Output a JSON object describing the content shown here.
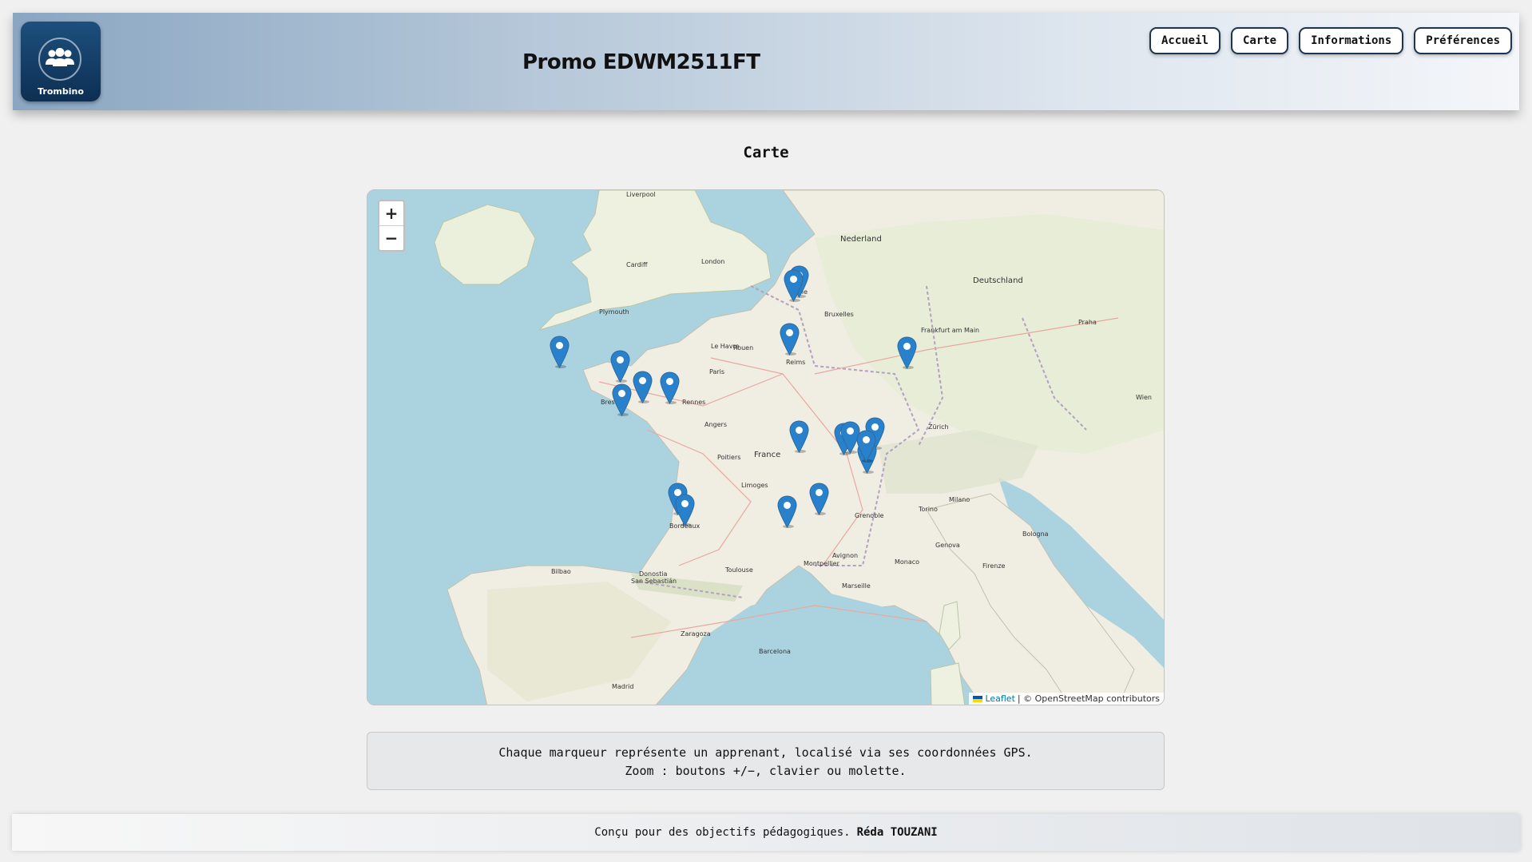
{
  "header": {
    "logo_label": "Trombino",
    "logo_icon": "users-group-icon",
    "title": "Promo EDWM2511FT",
    "nav": [
      "Accueil",
      "Carte",
      "Informations",
      "Préférences"
    ]
  },
  "main": {
    "section_title": "Carte",
    "map": {
      "zoom_in_label": "+",
      "zoom_out_label": "−",
      "attribution_link": "Leaflet",
      "attribution_text": "| © OpenStreetMap contributors",
      "marker_count": 19,
      "marker_icon": "map-pin-icon",
      "marker_color": "#2a81cb",
      "place_labels": [
        "Paris",
        "Brest",
        "Rennes",
        "Angers",
        "Bordeaux",
        "Toulouse",
        "Montpellier",
        "Marseille",
        "Grenoble",
        "Limoges",
        "Poitiers",
        "London",
        "Liverpool",
        "Cardiff",
        "Plymouth",
        "Bruxelles",
        "Lille",
        "Zürich",
        "Milano",
        "Torino",
        "Genova",
        "Bologna",
        "Firenze",
        "Frankfurt am Main",
        "Praha",
        "Wien",
        "Madrid",
        "Barcelona",
        "Zaragoza",
        "Monaco",
        "Avignon",
        "France",
        "Nederland",
        "Deutschland",
        "Bilbao",
        "Donostia",
        "San Sebastián",
        "Reims",
        "Rouen",
        "Le Havre"
      ]
    },
    "info_lines": [
      "Chaque marqueur représente un apprenant, localisé via ses coordonnées GPS.",
      "Zoom : boutons +/−, clavier ou molette."
    ]
  },
  "footer": {
    "text": "Conçu pour des objectifs pédagogiques.",
    "author": "Réda TOUZANI"
  }
}
